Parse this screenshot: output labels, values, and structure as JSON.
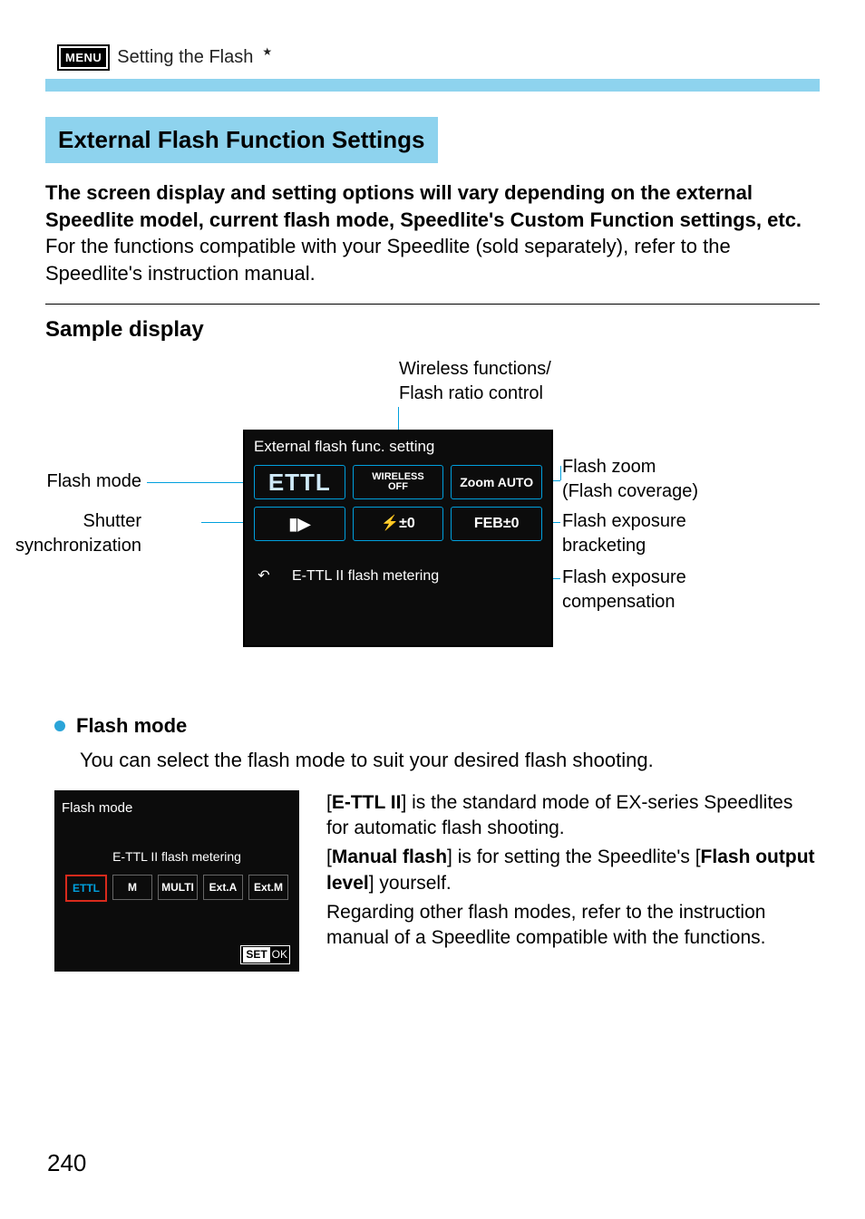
{
  "header": {
    "menu_badge": "MENU",
    "title": "Setting the Flash",
    "star": "★"
  },
  "section_title": "External Flash Function Settings",
  "intro": {
    "bold": "The screen display and setting options will vary depending on the external Speedlite model, current flash mode, Speedlite's Custom Function settings, etc.",
    "rest": "For the functions compatible with your Speedlite (sold separately), refer to the Speedlite's instruction manual."
  },
  "sample": {
    "heading": "Sample display",
    "callouts": {
      "top": "Wireless functions/\nFlash ratio control",
      "left1": "Flash mode",
      "left2": "Shutter\nsynchronization",
      "right1": "Flash zoom\n(Flash coverage)",
      "right2": "Flash exposure\nbracketing",
      "right3": "Flash exposure\ncompensation"
    },
    "lcd": {
      "title": "External flash func. setting",
      "ettl": "ETTL",
      "wireless_top": "WIRELESS",
      "wireless_bottom": "OFF",
      "zoom": "Zoom AUTO",
      "sync": "▮▶",
      "comp": "⚡±0",
      "feb": "FEB±0",
      "back": "↶",
      "status": "E-TTL II flash metering"
    }
  },
  "flash_mode": {
    "heading": "Flash mode",
    "lead": "You can select the flash mode to suit your desired flash shooting.",
    "lcd": {
      "title": "Flash mode",
      "subtitle": "E-TTL II flash metering",
      "options": [
        "ETTL",
        "M",
        "MULTI",
        "Ext.A",
        "Ext.M"
      ],
      "set": "SET",
      "ok": "OK"
    },
    "text": {
      "p1a": "[",
      "p1b": "E-TTL II",
      "p1c": "] is the standard mode of EX-series Speedlites for automatic flash shooting.",
      "p2a": "[",
      "p2b": "Manual flash",
      "p2c": "] is for setting the Speedlite's [",
      "p2d": "Flash output level",
      "p2e": "] yourself.",
      "p3": "Regarding other flash modes, refer to the instruction manual of a Speedlite compatible with the functions."
    }
  },
  "page_number": "240"
}
